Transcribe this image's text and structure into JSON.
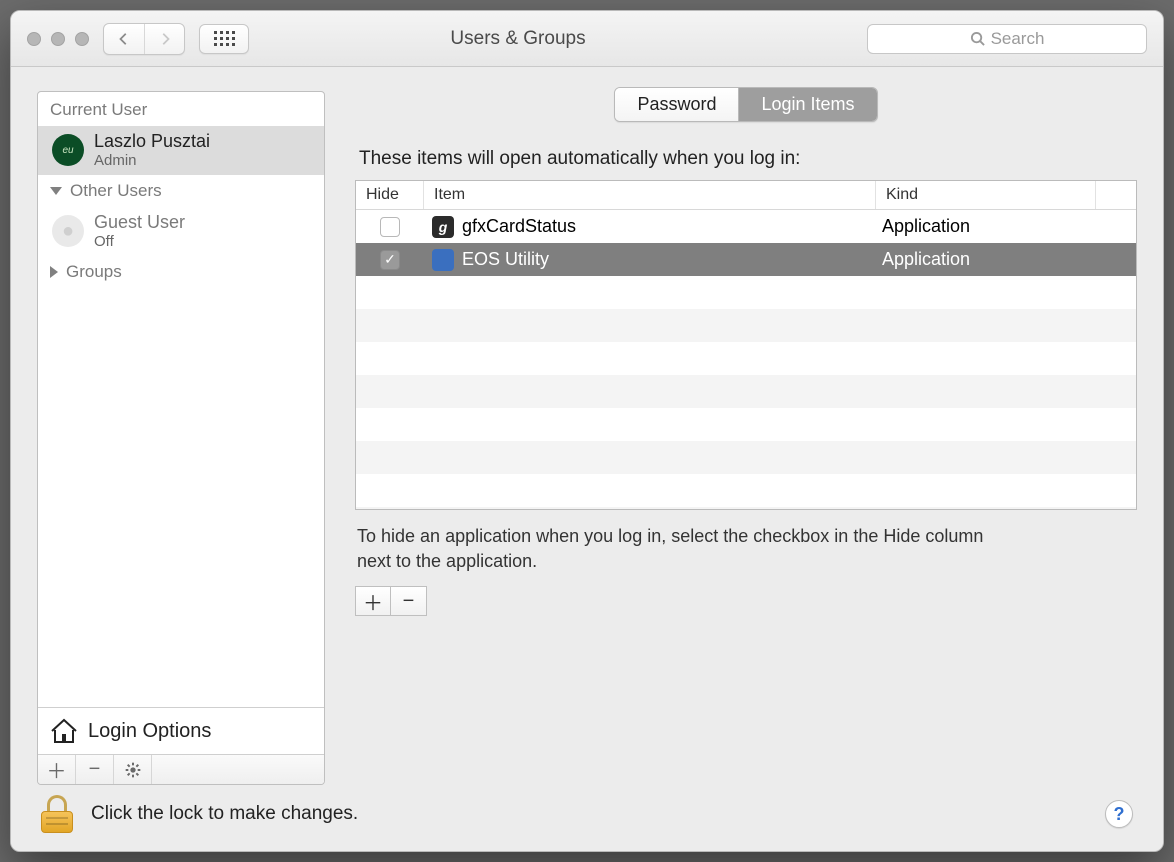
{
  "window": {
    "title": "Users & Groups"
  },
  "search": {
    "placeholder": "Search"
  },
  "sidebar": {
    "current_user_heading": "Current User",
    "current_user": {
      "name": "Laszlo Pusztai",
      "role": "Admin"
    },
    "other_users_heading": "Other Users",
    "guest": {
      "name": "Guest User",
      "status": "Off"
    },
    "groups_heading": "Groups",
    "login_options": "Login Options"
  },
  "tabs": {
    "password": "Password",
    "login_items": "Login Items"
  },
  "main": {
    "lead": "These items will open automatically when you log in:",
    "columns": {
      "hide": "Hide",
      "item": "Item",
      "kind": "Kind"
    },
    "rows": [
      {
        "hide": false,
        "item": "gfxCardStatus",
        "kind": "Application",
        "icon": "g",
        "selected": false
      },
      {
        "hide": true,
        "item": "EOS Utility",
        "kind": "Application",
        "icon": "cam",
        "selected": true
      }
    ],
    "hint": "To hide an application when you log in, select the checkbox in the Hide column next to the application."
  },
  "footer": {
    "lock_text": "Click the lock to make changes."
  }
}
